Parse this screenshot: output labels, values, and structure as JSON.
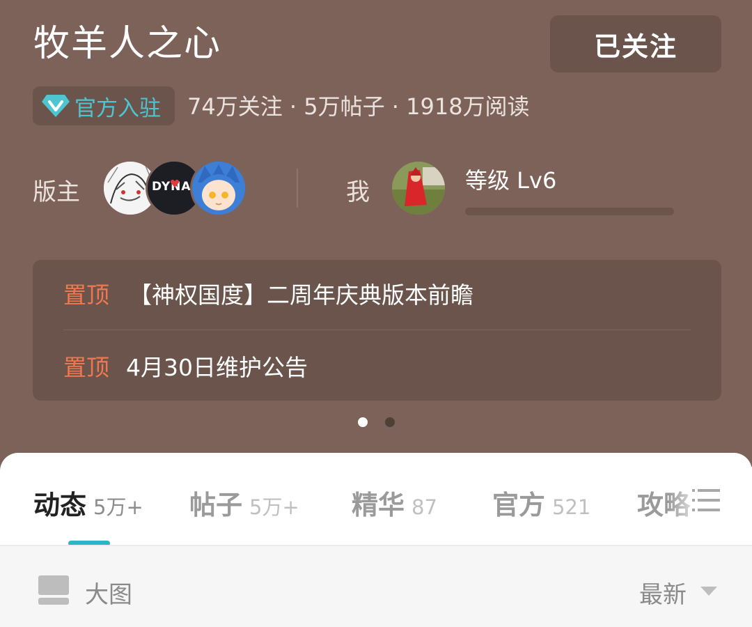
{
  "forum": {
    "title": "牧羊人之心",
    "follow_label": "已关注",
    "badge_label": "官方入驻",
    "stats": "74万关注 · 5万帖子 · 1918万阅读"
  },
  "moderators": {
    "label": "版主",
    "avatars": [
      "moderator-avatar-1",
      "moderator-avatar-2",
      "moderator-avatar-3"
    ],
    "avatar2_text": "DYNA"
  },
  "me": {
    "label": "我",
    "level": "等级 Lv6",
    "level_progress": 0
  },
  "pinned": [
    {
      "tag": "置顶",
      "title": "【神权国度】二周年庆典版本前瞻"
    },
    {
      "tag": "置顶",
      "title": "4月30日维护公告"
    }
  ],
  "carousel": {
    "total": 2,
    "active": 0
  },
  "tabs": [
    {
      "label": "动态",
      "count": "5万+",
      "active": true
    },
    {
      "label": "帖子",
      "count": "5万+",
      "active": false
    },
    {
      "label": "精华",
      "count": "87",
      "active": false
    },
    {
      "label": "官方",
      "count": "521",
      "active": false
    },
    {
      "label": "攻略",
      "count": "",
      "active": false
    }
  ],
  "filter": {
    "view_label": "大图",
    "sort_label": "最新"
  },
  "colors": {
    "header_bg": "#7d6259",
    "panel_bg": "#6a544c",
    "accent_teal": "#2ab7c3",
    "pin_orange": "#f0784f"
  },
  "icons": {
    "badge": "diamond-v-icon",
    "menu": "menu-lines-icon",
    "view": "large-image-view-icon",
    "sort": "caret-down-icon"
  }
}
